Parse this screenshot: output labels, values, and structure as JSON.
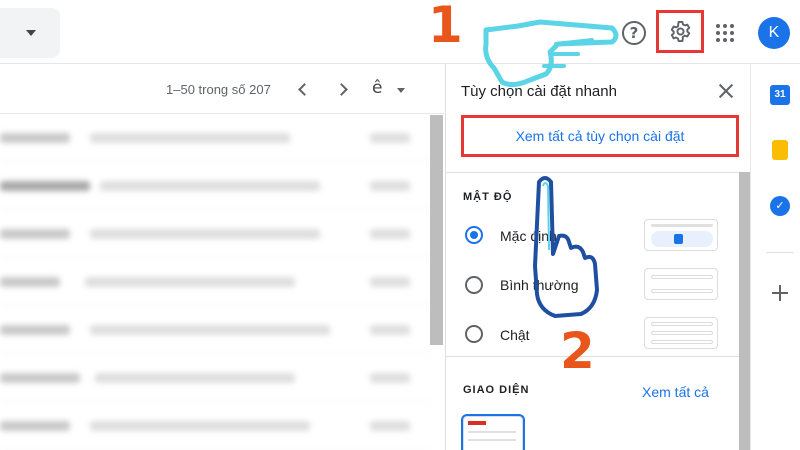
{
  "topbar": {
    "avatar_letter": "K",
    "help_symbol": "?"
  },
  "toolbar": {
    "pagination": "1–50 trong số 207",
    "input_tools": "ê"
  },
  "quick_settings": {
    "title": "Tùy chọn cài đặt nhanh",
    "see_all_settings": "Xem tất cả tùy chọn cài đặt",
    "density": {
      "heading": "MẬT ĐỘ",
      "options": [
        "Mặc định",
        "Bình thường",
        "Chật"
      ],
      "selected": "Mặc định"
    },
    "theme": {
      "heading": "GIAO DIỆN",
      "see_all": "Xem tất cả"
    }
  },
  "side_panel": {
    "calendar_day": "31",
    "tasks_symbol": "✓"
  },
  "annotations": {
    "step1": "1",
    "step2": "2"
  },
  "colors": {
    "highlight_box": "#e53935",
    "step_number": "#e8561b",
    "link_blue": "#1a73e8",
    "hand_outline_1": "#5ad4e6",
    "hand_outline_2": "#1f4fa0"
  },
  "icons": [
    "search-dropdown-icon",
    "help-icon",
    "settings-gear-icon",
    "apps-grid-icon",
    "close-icon",
    "calendar-icon",
    "keep-icon",
    "tasks-icon",
    "add-icon",
    "pointing-hand-icon"
  ]
}
